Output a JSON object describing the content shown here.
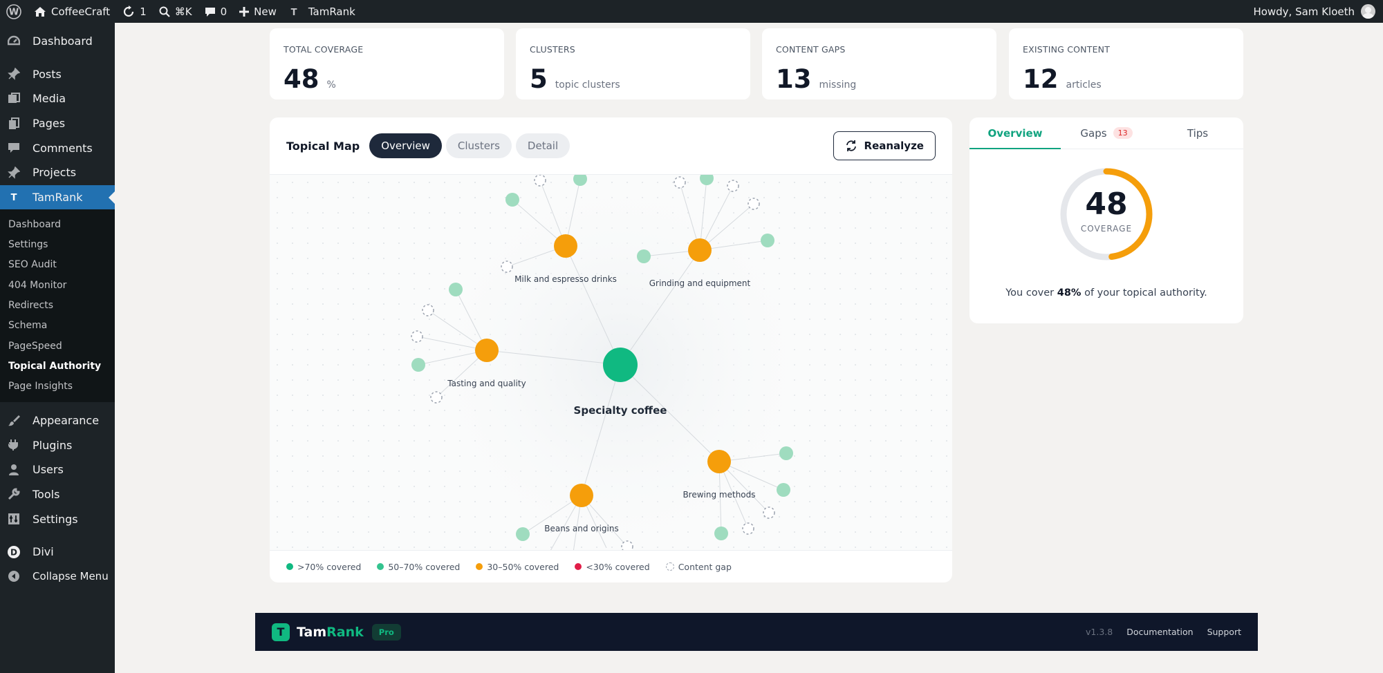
{
  "admin_bar": {
    "site_name": "CoffeeCraft",
    "updates_count": "1",
    "search_shortcut": "⌘K",
    "comments_count": "0",
    "new_label": "New",
    "plugin_label": "TamRank",
    "greeting": "Howdy, Sam Kloeth"
  },
  "sidebar": {
    "top_items": [
      {
        "label": "Dashboard",
        "icon": "dashboard-icon"
      }
    ],
    "items": [
      {
        "label": "Posts",
        "icon": "pin-icon"
      },
      {
        "label": "Media",
        "icon": "media-icon"
      },
      {
        "label": "Pages",
        "icon": "pages-icon"
      },
      {
        "label": "Comments",
        "icon": "comment-icon"
      },
      {
        "label": "Projects",
        "icon": "pin-icon"
      },
      {
        "label": "TamRank",
        "icon": "tamrank-icon"
      }
    ],
    "submenu": [
      "Dashboard",
      "Settings",
      "SEO Audit",
      "404 Monitor",
      "Redirects",
      "Schema",
      "PageSpeed",
      "Topical Authority",
      "Page Insights"
    ],
    "active_submenu": "Topical Authority",
    "bottom_items": [
      {
        "label": "Appearance",
        "icon": "brush-icon"
      },
      {
        "label": "Plugins",
        "icon": "plug-icon"
      },
      {
        "label": "Users",
        "icon": "user-icon"
      },
      {
        "label": "Tools",
        "icon": "wrench-icon"
      },
      {
        "label": "Settings",
        "icon": "settings-icon"
      },
      {
        "label": "Divi",
        "icon": "divi-icon"
      },
      {
        "label": "Collapse Menu",
        "icon": "collapse-icon"
      }
    ]
  },
  "stats": [
    {
      "label": "TOTAL COVERAGE",
      "value": "48",
      "unit": "%"
    },
    {
      "label": "CLUSTERS",
      "value": "5",
      "unit": "topic clusters"
    },
    {
      "label": "CONTENT GAPS",
      "value": "13",
      "unit": "missing"
    },
    {
      "label": "EXISTING CONTENT",
      "value": "12",
      "unit": "articles"
    }
  ],
  "map": {
    "title": "Topical Map",
    "views": [
      "Overview",
      "Clusters",
      "Detail"
    ],
    "active_view": "Overview",
    "reanalyze_label": "Reanalyze",
    "center_topic": "Specialty coffee",
    "clusters": [
      "Milk and espresso drinks",
      "Grinding and equipment",
      "Tasting and quality",
      "Brewing methods",
      "Beans and origins"
    ]
  },
  "legend": [
    {
      "label": ">70% covered",
      "color": "#10b981"
    },
    {
      "label": "50–70% covered",
      "color": "#34c38f"
    },
    {
      "label": "30–50% covered",
      "color": "#f59e0b"
    },
    {
      "label": "<30% covered",
      "color": "#e11d48"
    },
    {
      "label": "Content gap",
      "color": "gap"
    }
  ],
  "panel": {
    "tabs": [
      "Overview",
      "Gaps",
      "Tips"
    ],
    "active_tab": "Overview",
    "gaps_badge": "13",
    "coverage_value": "48",
    "coverage_fraction": 0.48,
    "coverage_label": "COVERAGE",
    "summary_prefix": "You cover",
    "summary_value": "48%",
    "summary_suffix": "of your topical authority."
  },
  "footer": {
    "brand_prefix": "Tam",
    "brand_suffix": "Rank",
    "logo_letter": "T",
    "tier": "Pro",
    "version": "v1.3.8",
    "links": [
      "Documentation",
      "Support"
    ]
  },
  "colors": {
    "accent": "#10b981",
    "wp_blue": "#2271b1",
    "orange": "#f59e0b",
    "dark": "#1e293b"
  }
}
